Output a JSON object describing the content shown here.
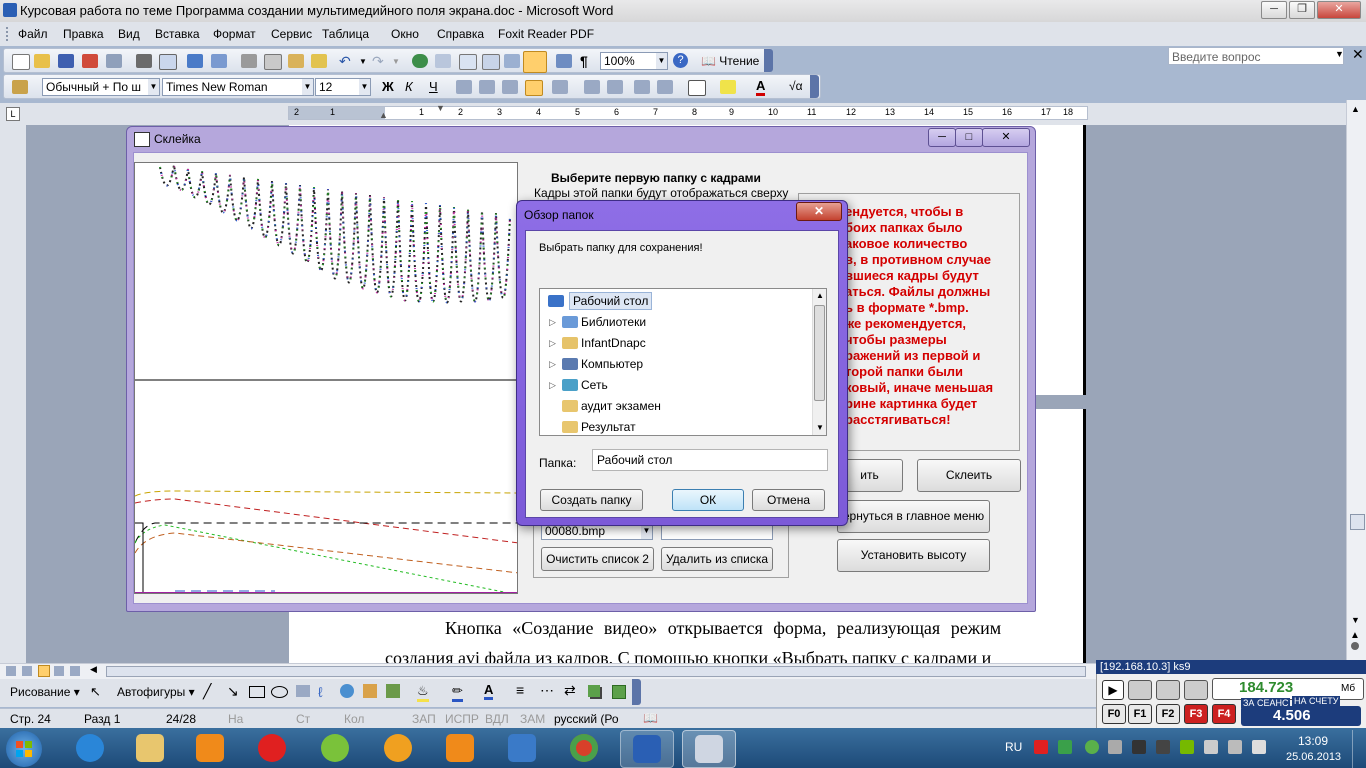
{
  "word": {
    "title": "Курсовая работа по теме Программа создании мультимедийного поля экрана.doc - Microsoft Word",
    "menu": [
      "Файл",
      "Правка",
      "Вид",
      "Вставка",
      "Формат",
      "Сервис",
      "Таблица",
      "Окно",
      "Справка",
      "Foxit Reader PDF"
    ],
    "help_placeholder": "Введите вопрос",
    "zoom": "100%",
    "reading_label": "Чтение",
    "style_combo": "Обычный + По ш",
    "font_combo": "Times New Roman",
    "size_combo": "12",
    "ruler_numbers": [
      "2",
      "1",
      "1",
      "2",
      "3",
      "4",
      "5",
      "6",
      "7",
      "8",
      "9",
      "10",
      "11",
      "12",
      "13",
      "14",
      "15",
      "16",
      "17",
      "18"
    ],
    "doc_line1": "Кнопка «Создание видео» открывается форма, реализующая режим",
    "doc_line2": "создания avi файла из кадров. С помощью кнопки «Выбрать папку с кадрами и",
    "draw_label": "Рисование",
    "autoshapes_label": "Автофигуры",
    "status": {
      "page": "Стр. 24",
      "section": "Разд 1",
      "pages": "24/28",
      "at": "На",
      "line": "Ст",
      "col": "Кол",
      "rec": "ЗАП",
      "trk": "ИСПР",
      "ext": "ВДЛ",
      "ovr": "ЗАМ",
      "lang": "русский (Ро"
    }
  },
  "skleika": {
    "title": "Склейка",
    "folder_heading": "Выберите первую папку  с кадрами",
    "folder_sub": "Кадры этой папки будут отображаться сверху",
    "info_text": "Рекомендуется, чтобы в обоих папках было одинаковое количество кадров, в противном случае оставшиеся кадры будут отбрасываться. Файлы должны быть в формате *.bmp. Также рекомендуется, чтобы размеры изображений из первой и второй папки были одинаковый, иначе меньшая по ширине картинка будет растягиваться!",
    "info_lines": [
      "ендуется, чтобы в",
      "боих папках было",
      "аковое количество",
      "в, в противном случае",
      "вшиеся кадры будут",
      "аться. Файлы должны",
      "ь в формате *.bmp.",
      "же рекомендуется,",
      "чтобы размеры",
      "ражений из первой и",
      "торой папки были",
      "ковый, иначе меньшая",
      "рине картинка будет",
      "расстягиваться!"
    ],
    "file_combo": "00080.bmp",
    "btn_clear2": "Очистить список 2",
    "btn_delete": "Удалить из списка",
    "btn_partial": "ить",
    "btn_glue": "Склеить",
    "btn_main_menu": "ернуться в главное меню",
    "btn_set_height": "Установить высоту"
  },
  "obzor": {
    "title": "Обзор папок",
    "prompt": "Выбрать папку для сохранения!",
    "tree": [
      {
        "label": "Рабочий стол",
        "icon": "desktop-icon",
        "selected": true,
        "expandable": false
      },
      {
        "label": "Библиотеки",
        "icon": "libraries-icon",
        "selected": false,
        "expandable": true
      },
      {
        "label": "InfantDnapc",
        "icon": "user-folder-icon",
        "selected": false,
        "expandable": true
      },
      {
        "label": "Компьютер",
        "icon": "computer-icon",
        "selected": false,
        "expandable": true
      },
      {
        "label": "Сеть",
        "icon": "network-icon",
        "selected": false,
        "expandable": true
      },
      {
        "label": "аудит экзамен",
        "icon": "folder-icon",
        "selected": false,
        "expandable": false
      },
      {
        "label": "Результат",
        "icon": "folder-icon",
        "selected": false,
        "expandable": false
      }
    ],
    "folder_label": "Папка:",
    "folder_value": "Рабочий стол",
    "btn_create": "Создать папку",
    "btn_ok": "ОК",
    "btn_cancel": "Отмена"
  },
  "counter": {
    "header": "[192.168.10.3] ks9",
    "session_value": "184.723",
    "unit": "Мб",
    "session_label": "ЗА СЕАНС",
    "account_label": "НА СЧЕТУ",
    "account_value": "4.506",
    "fkeys": [
      "F0",
      "F1",
      "F2",
      "F3",
      "F4"
    ]
  },
  "taskbar": {
    "lang": "RU",
    "time": "13:09",
    "date": "25.06.2013"
  },
  "colors": {
    "dialog_purple": "#b5a7dc",
    "info_red": "#d40000",
    "taskbar_blue": "#1d4a78"
  }
}
